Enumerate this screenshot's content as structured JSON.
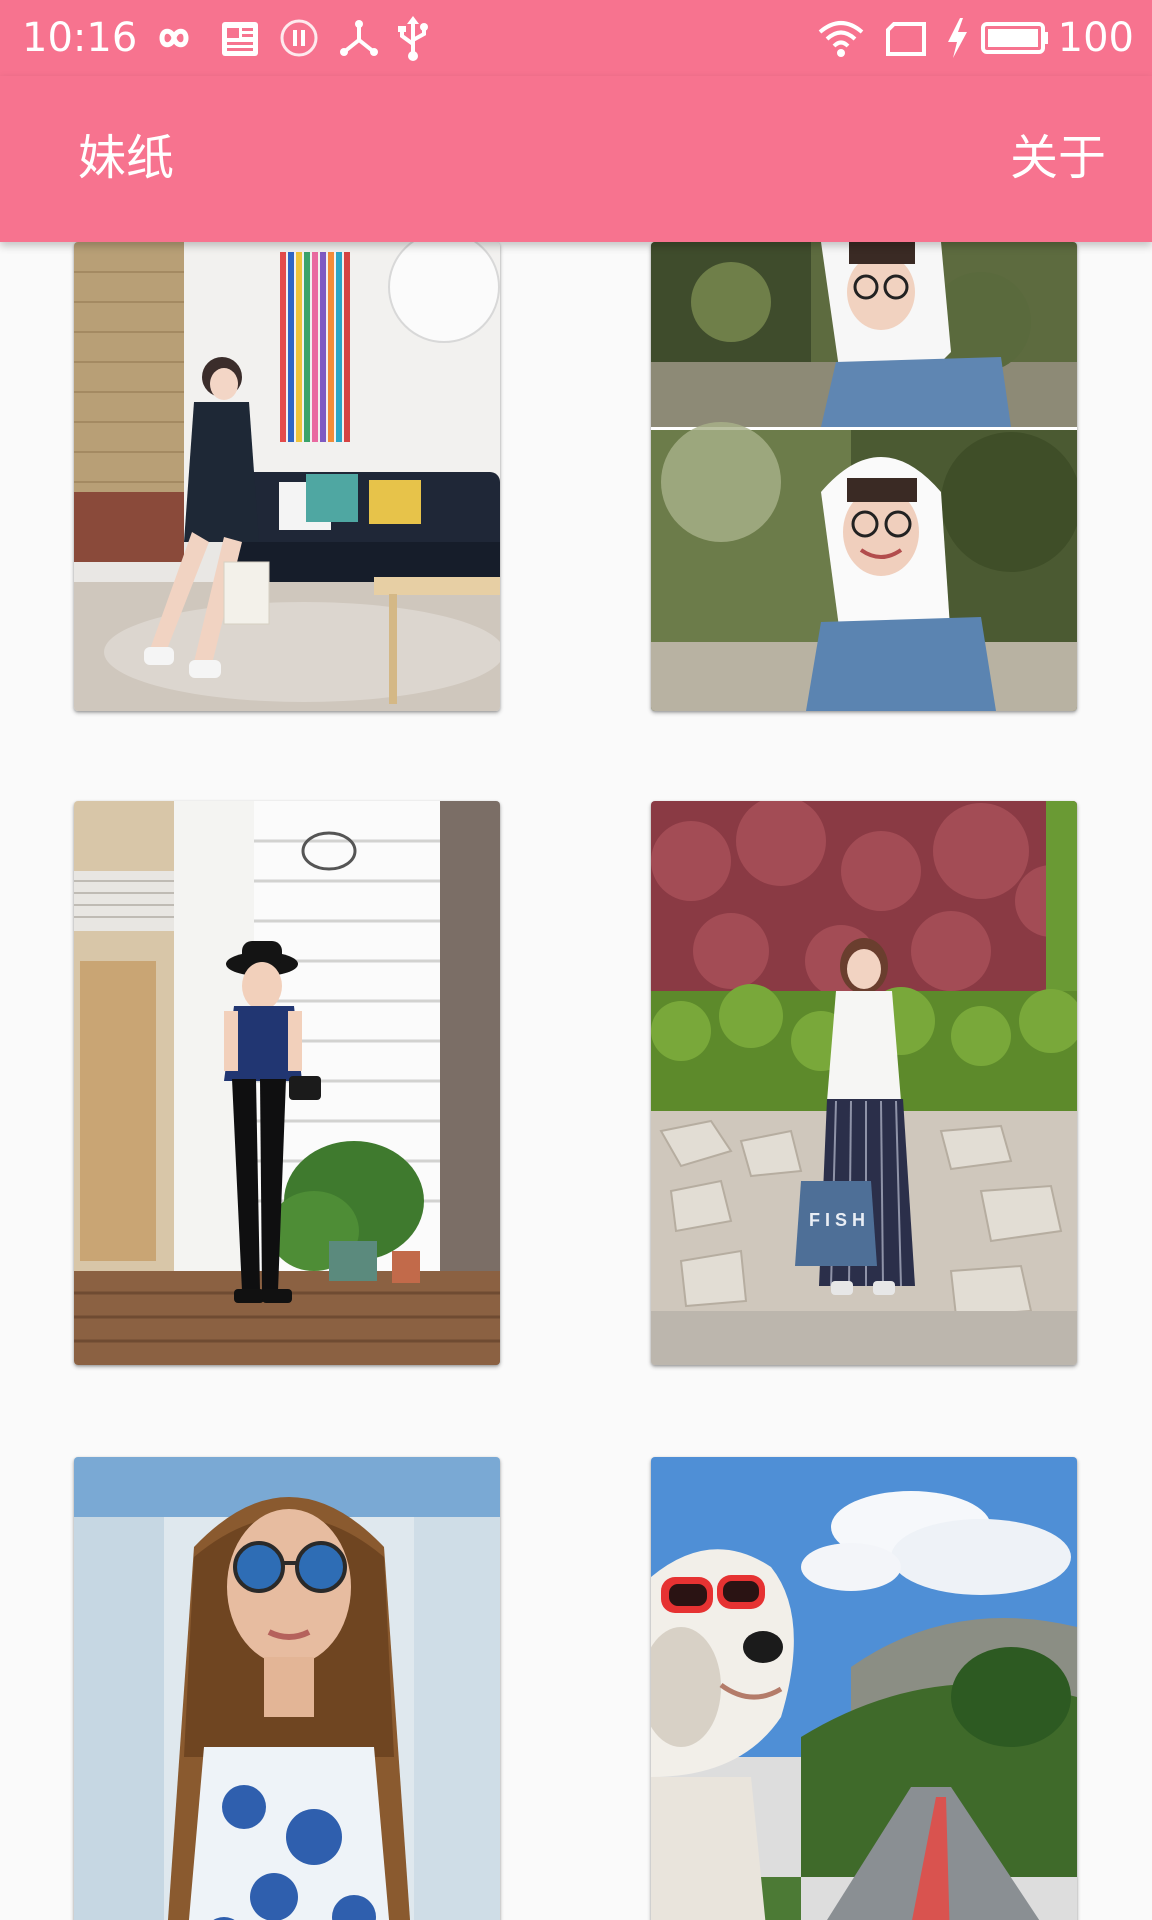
{
  "status_bar": {
    "time": "10:16",
    "battery_level": "100",
    "icons": [
      "infinity-icon",
      "news-icon",
      "pause-icon",
      "network-icon",
      "usb-icon",
      "wifi-icon",
      "screen-rotate-icon",
      "charging-bolt-icon",
      "battery-icon"
    ]
  },
  "toolbar": {
    "title": "妹纸",
    "about_label": "关于"
  },
  "colors": {
    "accent": "#f7738f",
    "background": "#fafafa"
  },
  "photos": [
    {
      "description": "girl in dark outfit on sofa with striped curtain"
    },
    {
      "description": "two photos of girl in white hood and denim jacket"
    },
    {
      "description": "girl in hat and velvet top by white wall"
    },
    {
      "description": "girl with tote bag in front of hedge wall"
    },
    {
      "description": "girl with round sunglasses and long hair"
    },
    {
      "description": "dog with red sunglasses on road"
    }
  ]
}
